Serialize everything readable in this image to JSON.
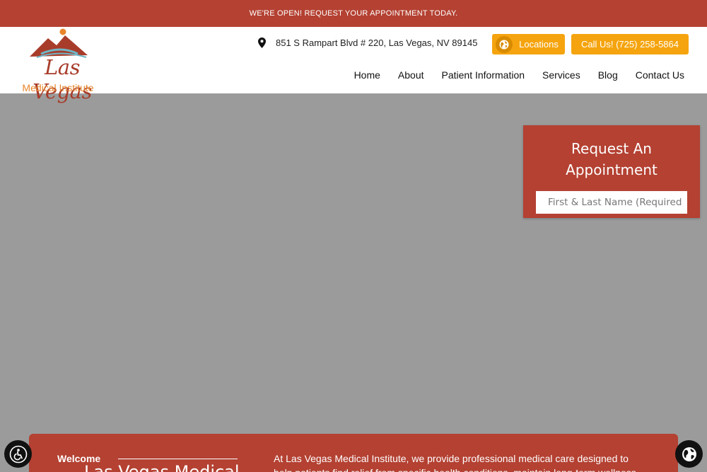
{
  "announcement": {
    "text": "WE'RE OPEN! REQUEST YOUR APPOINTMENT TODAY."
  },
  "logo": {
    "script_text": "Las Vegas",
    "subtitle": "Medical Institute",
    "icon": "mountain-sun-logo"
  },
  "header": {
    "address": "851 S Rampart Blvd # 220, Las Vegas, NV 89145",
    "locations_label": "Locations",
    "call_label": "Call Us! (725) 258-5864"
  },
  "nav": {
    "items": [
      "Home",
      "About",
      "Patient Information",
      "Services",
      "Blog",
      "Contact Us"
    ]
  },
  "appointment_form": {
    "title": "Request An Appointment",
    "name_placeholder": "First & Last Name (Required)*"
  },
  "welcome": {
    "kicker": "Welcome",
    "heading": "Las Vegas Medical",
    "intro": "At Las Vegas Medical Institute, we provide professional medical care designed to help patients find relief from specific health conditions, maintain long-term wellness, and"
  },
  "colors": {
    "brand_red": "#b44132",
    "accent_orange": "#f5a40f",
    "logo_orange": "#e8862a"
  },
  "icons": {
    "address": "map-pin-icon",
    "locations": "globe-icon",
    "accessibility": "accessibility-icon",
    "language": "globe-icon"
  }
}
